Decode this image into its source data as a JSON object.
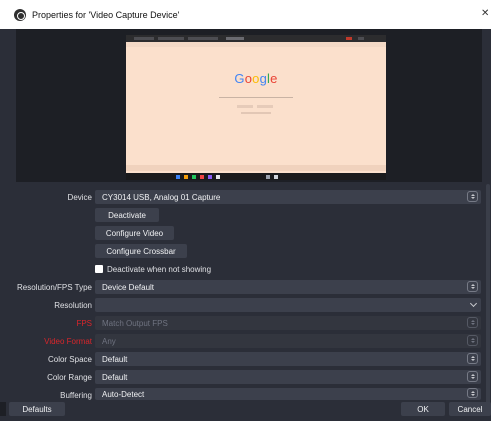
{
  "window": {
    "title": "Properties for 'Video Capture Device'",
    "close_glyph": "✕"
  },
  "preview": {
    "google_logo_letters": [
      {
        "ch": "G",
        "color": "#4285f4"
      },
      {
        "ch": "o",
        "color": "#ea4335"
      },
      {
        "ch": "o",
        "color": "#fbbc05"
      },
      {
        "ch": "g",
        "color": "#4285f4"
      },
      {
        "ch": "l",
        "color": "#34a853"
      },
      {
        "ch": "e",
        "color": "#ea4335"
      }
    ]
  },
  "form": {
    "device": {
      "label": "Device",
      "value": "CY3014 USB, Analog 01 Capture"
    },
    "deactivate_label": "Deactivate",
    "configure_video_label": "Configure Video",
    "configure_crossbar_label": "Configure Crossbar",
    "deactivate_when_hidden_label": "Deactivate when not showing",
    "resolution_fps_type": {
      "label": "Resolution/FPS Type",
      "value": "Device Default"
    },
    "resolution": {
      "label": "Resolution",
      "value": ""
    },
    "fps": {
      "label": "FPS",
      "value": "Match Output FPS"
    },
    "video_format": {
      "label": "Video Format",
      "value": "Any"
    },
    "color_space": {
      "label": "Color Space",
      "value": "Default"
    },
    "color_range": {
      "label": "Color Range",
      "value": "Default"
    },
    "buffering": {
      "label": "Buffering",
      "value": "Auto-Detect"
    }
  },
  "footer": {
    "defaults_label": "Defaults",
    "ok_label": "OK",
    "cancel_label": "Cancel"
  },
  "colors": {
    "window_bg": "#2b2e38",
    "control_bg": "#3c404c",
    "warning_label": "#d8262b",
    "preview_bg": "#1d1f25"
  }
}
